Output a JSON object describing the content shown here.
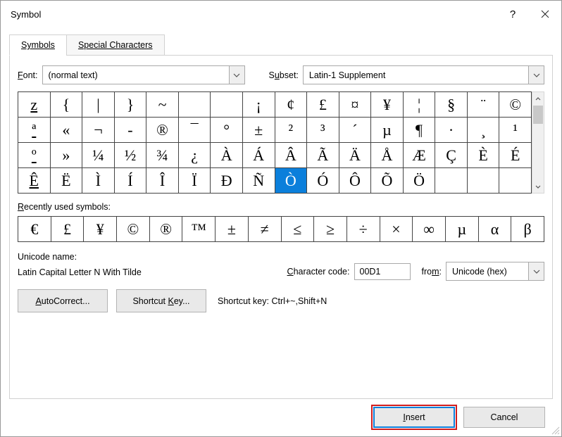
{
  "title": "Symbol",
  "tabs": {
    "symbols": "Symbols",
    "special": "Special Characters"
  },
  "font": {
    "label": "Font:",
    "value": "(normal text)"
  },
  "subset": {
    "label": "Subset:",
    "value": "Latin-1 Supplement"
  },
  "symbols": [
    "z",
    "{",
    "|",
    "}",
    "~",
    "",
    "",
    "¡",
    "¢",
    "£",
    "¤",
    "¥",
    "¦",
    "§",
    "¨",
    "©",
    "ª",
    "«",
    "¬",
    "-",
    "®",
    "¯",
    "°",
    "±",
    "²",
    "³",
    "´",
    "µ",
    "¶",
    "·",
    "¸",
    "¹",
    "º",
    "»",
    "¼",
    "½",
    "¾",
    "¿",
    "À",
    "Á",
    "Â",
    "Ã",
    "Ä",
    "Å",
    "Æ",
    "Ç",
    "È",
    "É",
    "Ê",
    "Ë",
    "Ì",
    "Í",
    "Î",
    "Ï",
    "Đ",
    "Ñ",
    "Ò",
    "Ó",
    "Ô",
    "Õ",
    "Ö"
  ],
  "blank_padding": [
    "",
    ""
  ],
  "selected_index": 56,
  "underline_indices": [
    0,
    16,
    32,
    48
  ],
  "recent_label": "Recently used symbols:",
  "recent": [
    "€",
    "£",
    "¥",
    "©",
    "®",
    "™",
    "±",
    "≠",
    "≤",
    "≥",
    "÷",
    "×",
    "∞",
    "µ",
    "α",
    "β"
  ],
  "unicode_name_label": "Unicode name:",
  "unicode_name_value": "Latin Capital Letter N With Tilde",
  "char_code_label": "Character code:",
  "char_code_value": "00D1",
  "from_label": "from:",
  "from_value": "Unicode (hex)",
  "buttons": {
    "autocorrect": "AutoCorrect...",
    "shortcutkey": "Shortcut Key...",
    "insert": "Insert",
    "cancel": "Cancel"
  },
  "shortcut_label": "Shortcut key:",
  "shortcut_value": "Ctrl+~,Shift+N"
}
